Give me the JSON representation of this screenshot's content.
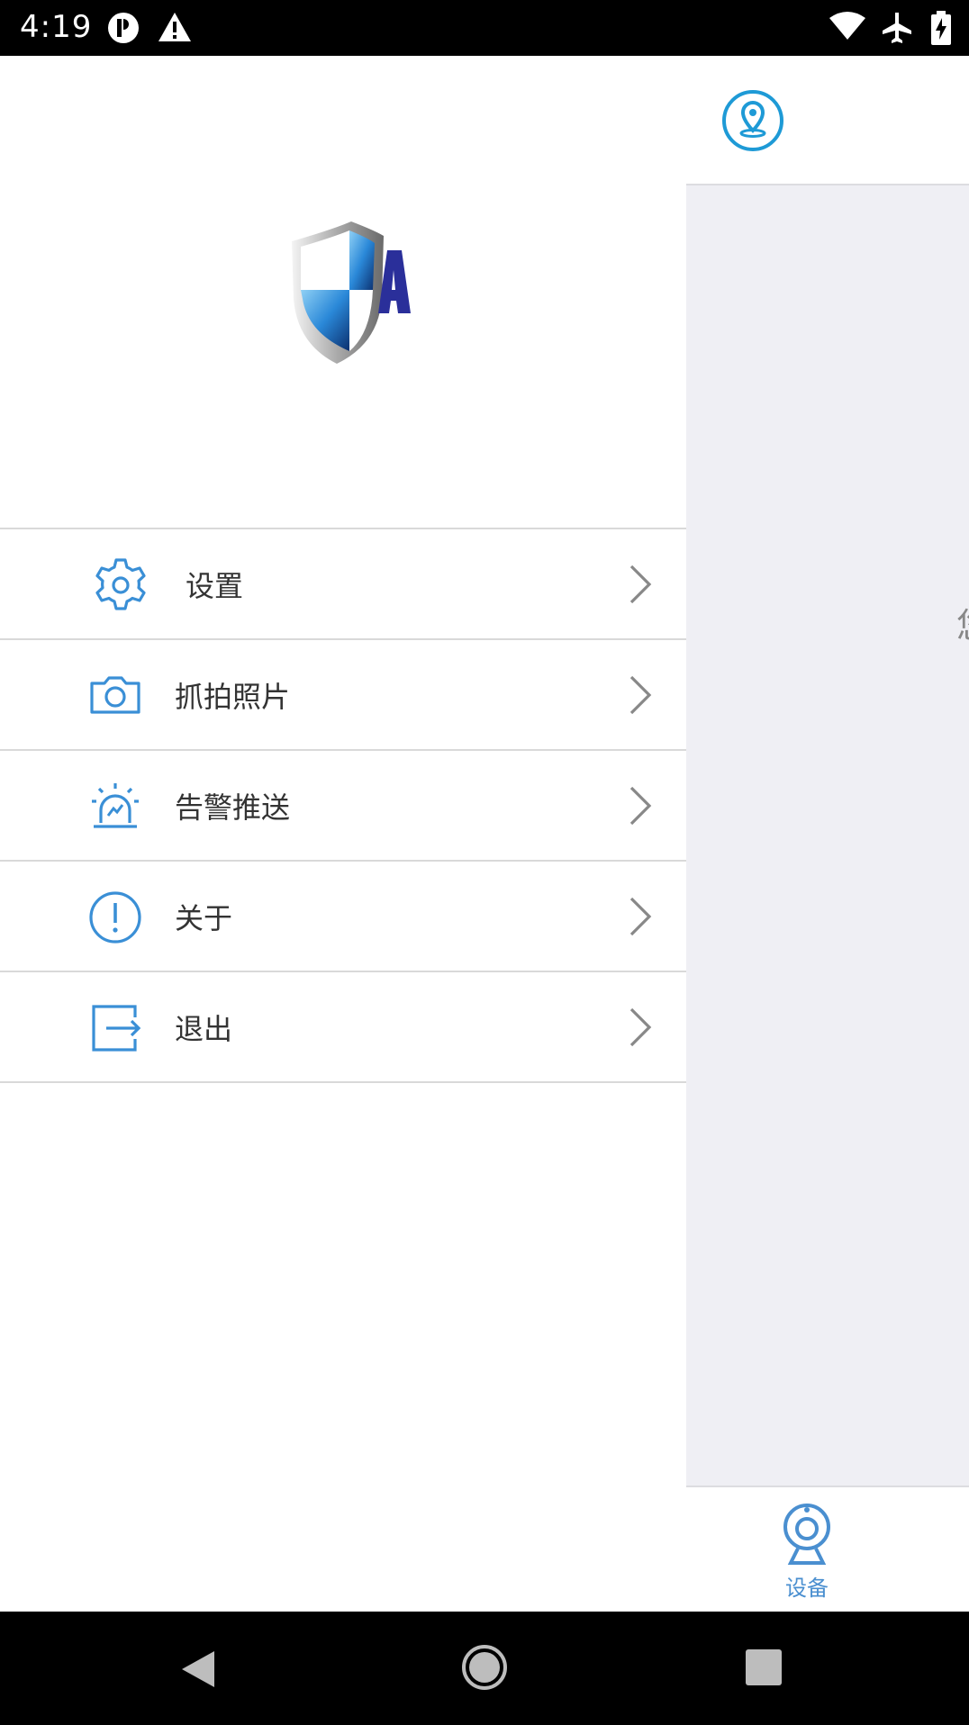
{
  "status_bar": {
    "time": "4:19",
    "left_icons": [
      "notification-app-icon",
      "warning-icon"
    ],
    "right_icons": [
      "wifi-icon",
      "airplane-mode-icon",
      "battery-charging-icon"
    ]
  },
  "background_app": {
    "header_icon": "location-pin-icon",
    "peek_text": "您",
    "tab_bar": {
      "items": [
        {
          "label": "设备",
          "icon": "webcam-icon"
        }
      ]
    }
  },
  "drawer": {
    "logo": "shield-a-logo",
    "menu": [
      {
        "label": "设置",
        "icon": "gear-icon"
      },
      {
        "label": "抓拍照片",
        "icon": "camera-icon"
      },
      {
        "label": "告警推送",
        "icon": "alarm-light-icon"
      },
      {
        "label": "关于",
        "icon": "info-exclamation-icon"
      },
      {
        "label": "退出",
        "icon": "logout-icon"
      }
    ]
  },
  "colors": {
    "accent": "#3a8fd6",
    "location_icon": "#1e9ad6",
    "tab_active": "#4a8fd0",
    "divider": "#d9d9d9",
    "background": "#efeff4"
  },
  "nav_bar": {
    "buttons": [
      "back-icon",
      "home-icon",
      "recents-icon"
    ]
  }
}
